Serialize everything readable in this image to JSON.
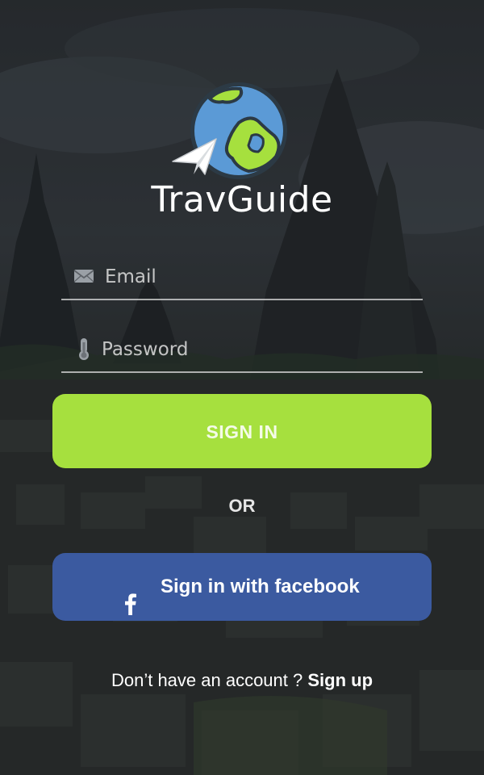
{
  "app": {
    "name": "TravGuide",
    "logo_icon": "globe-with-paper-plane-icon"
  },
  "form": {
    "email": {
      "placeholder": "Email",
      "value": "",
      "icon": "envelope-icon"
    },
    "password": {
      "placeholder": "Password",
      "value": "",
      "icon": "thermometer-icon"
    }
  },
  "buttons": {
    "signin_label": "SIGN IN",
    "divider_label": "OR",
    "facebook_label": "Sign in with facebook",
    "facebook_icon": "facebook-icon"
  },
  "footer": {
    "prompt": "Don’t have an account ?",
    "signup_label": "Sign up"
  },
  "colors": {
    "signin_button": "#a6e03e",
    "facebook_button": "#3b5aa0",
    "globe_ocean": "#5b9ad6",
    "globe_land": "#a6e03e",
    "globe_outline": "#2c3a45"
  }
}
